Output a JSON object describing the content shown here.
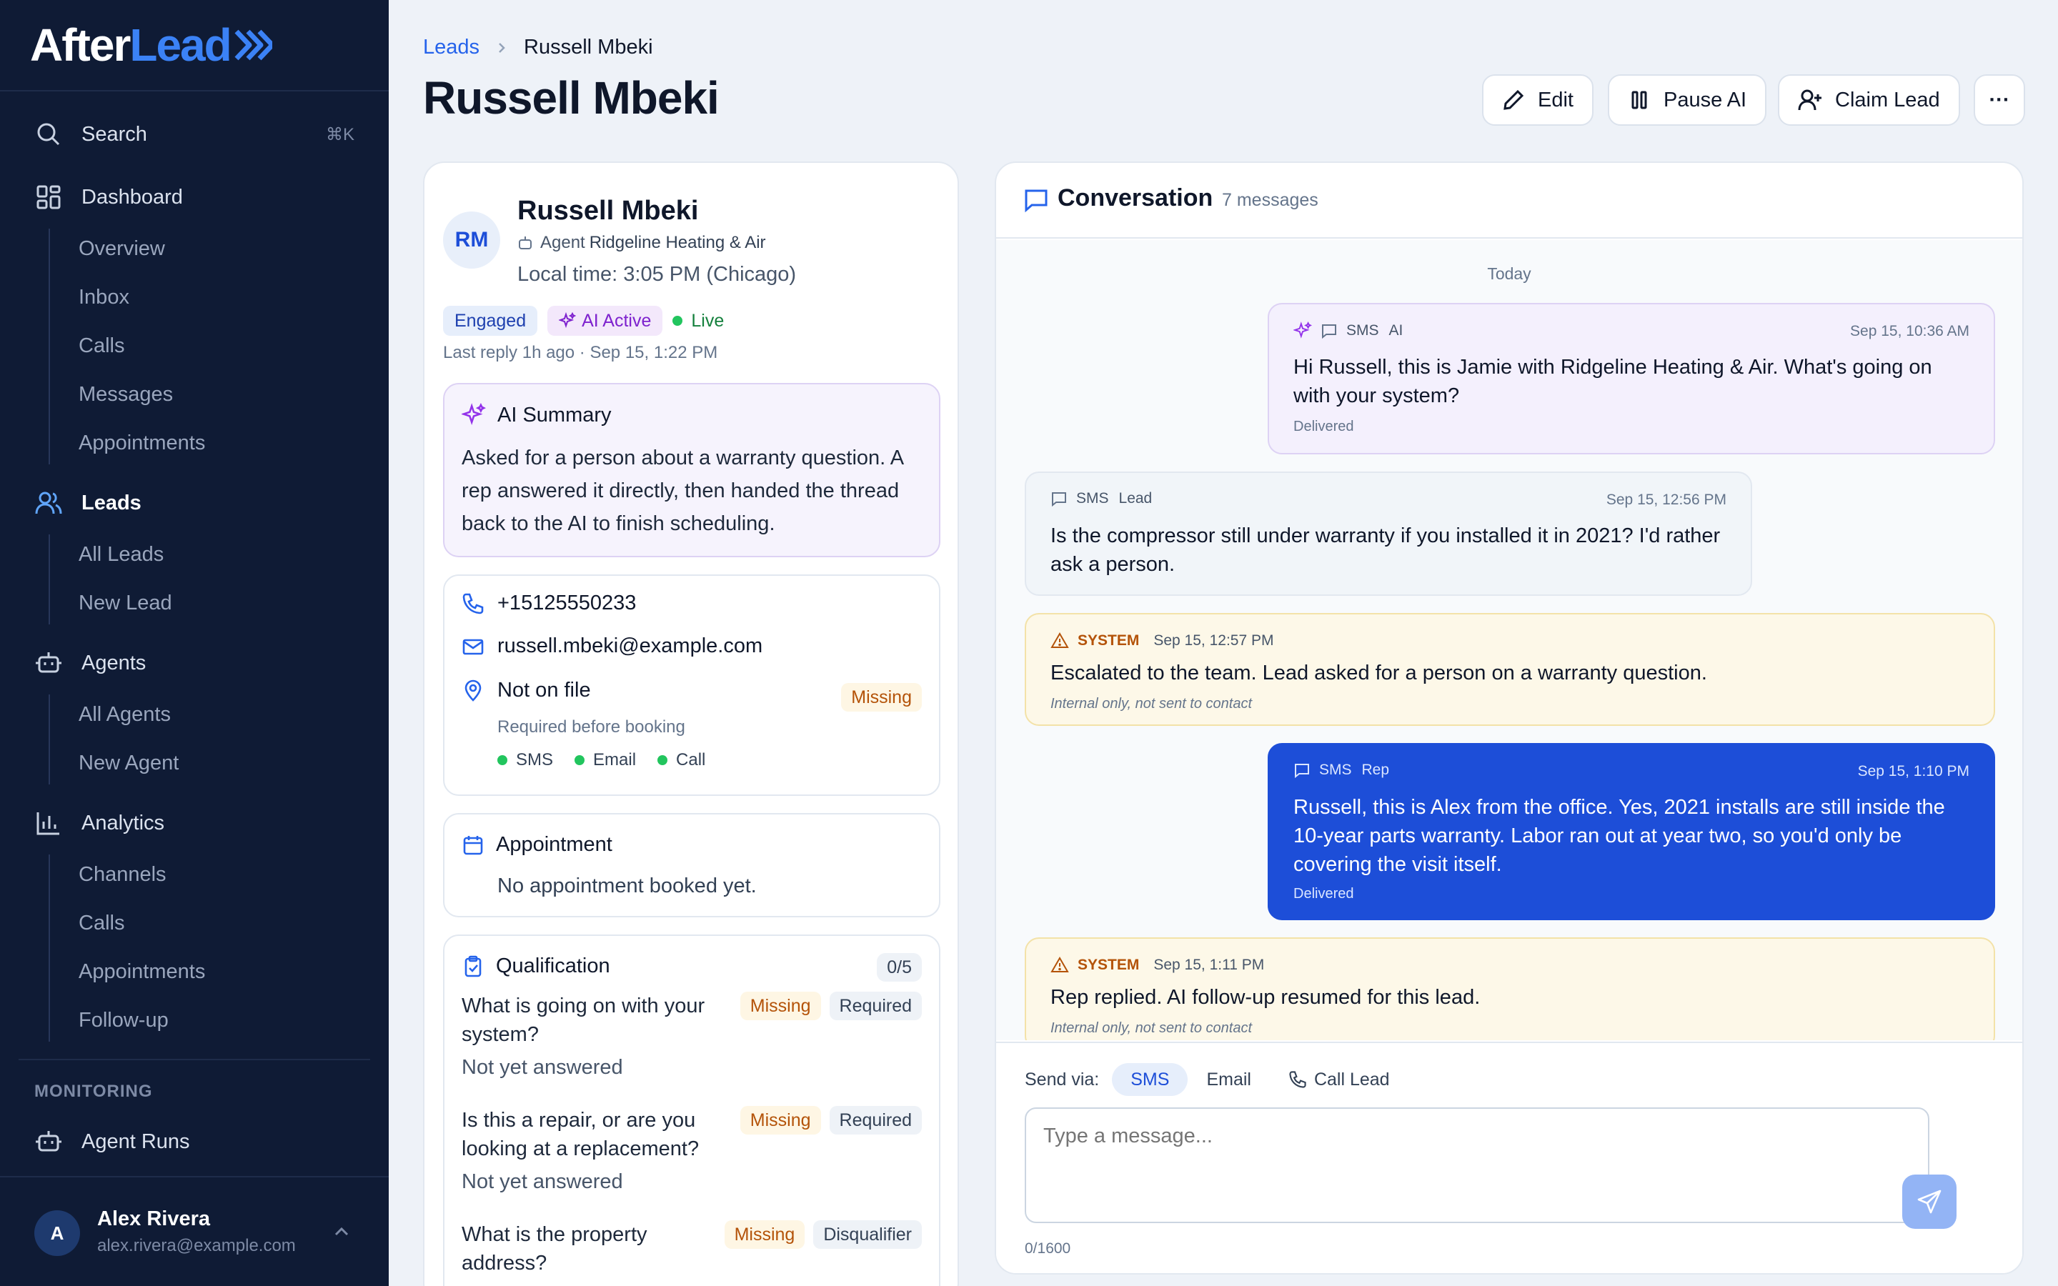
{
  "sidebar": {
    "logo_a": "After",
    "logo_b": "Lead",
    "search_label": "Search",
    "search_shortcut": "⌘K",
    "dashboard": {
      "label": "Dashboard",
      "items": [
        "Overview",
        "Inbox",
        "Calls",
        "Messages",
        "Appointments"
      ]
    },
    "leads": {
      "label": "Leads",
      "items": [
        "All Leads",
        "New Lead"
      ]
    },
    "agents": {
      "label": "Agents",
      "items": [
        "All Agents",
        "New Agent"
      ]
    },
    "analytics": {
      "label": "Analytics",
      "items": [
        "Channels",
        "Calls",
        "Appointments",
        "Follow-up"
      ]
    },
    "monitoring_label": "MONITORING",
    "agent_runs_label": "Agent Runs",
    "user": {
      "initial": "A",
      "name": "Alex Rivera",
      "email": "alex.rivera@example.com"
    }
  },
  "header": {
    "breadcrumb_root": "Leads",
    "breadcrumb_current": "Russell Mbeki",
    "title": "Russell Mbeki",
    "edit_label": "Edit",
    "pause_label": "Pause AI",
    "claim_label": "Claim Lead",
    "more_label": "···"
  },
  "lead": {
    "initials": "RM",
    "name": "Russell Mbeki",
    "agent_prefix": "Agent",
    "agent_name": "Ridgeline Heating & Air",
    "local_time": "Local time: 3:05 PM (Chicago)",
    "status_chip": "Engaged",
    "ai_chip": "AI Active",
    "live_chip": "Live",
    "last_reply": "Last reply 1h ago · Sep 15, 1:22 PM",
    "ai_summary_title": "AI Summary",
    "ai_summary_text": "Asked for a person about a warranty question. A rep answered it directly, then handed the thread back to the AI to finish scheduling.",
    "phone": "+15125550233",
    "email": "russell.mbeki@example.com",
    "address": "Not on file",
    "address_badge": "Missing",
    "address_note": "Required before booking",
    "channels": [
      "SMS",
      "Email",
      "Call"
    ],
    "appointment_title": "Appointment",
    "appointment_text": "No appointment booked yet.",
    "qualification_title": "Qualification",
    "qualification_count": "0/5",
    "questions": [
      {
        "q": "What is going on with your system?",
        "a": "Not yet answered",
        "status": "Missing",
        "kind": "Required"
      },
      {
        "q": "Is this a repair, or are you looking at a replacement?",
        "a": "Not yet answered",
        "status": "Missing",
        "kind": "Required"
      },
      {
        "q": "What is the property address?",
        "a": "",
        "status": "Missing",
        "kind": "Disqualifier"
      }
    ]
  },
  "conversation": {
    "title": "Conversation",
    "count": "7 messages",
    "day_label": "Today",
    "messages": [
      {
        "channel": "SMS",
        "sender": "AI",
        "time": "Sep 15, 10:36 AM",
        "text": "Hi Russell, this is Jamie with Ridgeline Heating & Air. What's going on with your system?",
        "footer": "Delivered"
      },
      {
        "channel": "SMS",
        "sender": "Lead",
        "time": "Sep 15, 12:56 PM",
        "text": "Is the compressor still under warranty if you installed it in 2021? I'd rather ask a person.",
        "footer": ""
      },
      {
        "channel": "SYSTEM",
        "sender": "",
        "time": "Sep 15, 12:57 PM",
        "text": "Escalated to the team. Lead asked for a person on a warranty question.",
        "footer": "Internal only, not sent to contact"
      },
      {
        "channel": "SMS",
        "sender": "Rep",
        "time": "Sep 15, 1:10 PM",
        "text": "Russell, this is Alex from the office. Yes, 2021 installs are still inside the 10-year parts warranty. Labor ran out at year two, so you'd only be covering the visit itself.",
        "footer": "Delivered"
      },
      {
        "channel": "SYSTEM",
        "sender": "",
        "time": "Sep 15, 1:11 PM",
        "text": "Rep replied. AI follow-up resumed for this lead.",
        "footer": "Internal only, not sent to contact"
      }
    ]
  },
  "composer": {
    "send_via_label": "Send via:",
    "options": [
      "SMS",
      "Email",
      "Call Lead"
    ],
    "placeholder": "Type a message...",
    "char_count": "0/1600"
  },
  "colors": {
    "sidebar_bg": "#0f1b35",
    "accent": "#2563eb",
    "rep_bubble": "#1d4ed8",
    "ai_bubble": "#f4f0fd",
    "system_bubble": "#fdf8e8",
    "missing": "#b45309",
    "live": "#22c55e"
  }
}
